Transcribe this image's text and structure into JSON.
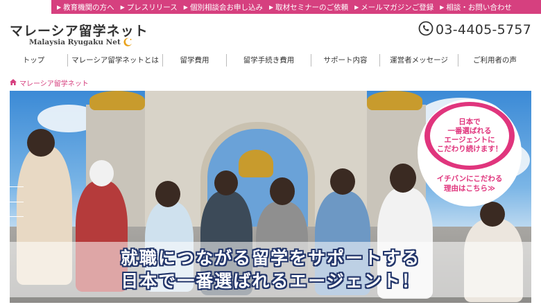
{
  "topbar": {
    "links": [
      "教育機関の方へ",
      "プレスリリース",
      "個別相談会お申し込み",
      "取材セミナーのご依頼",
      "メールマガジンご登録",
      "相談・お問い合わせ"
    ]
  },
  "header": {
    "logo_main": "マレーシア留学ネット",
    "logo_sub": "Malaysia Ryugaku Net",
    "phone": "03-4405-5757"
  },
  "nav": {
    "items": [
      "トップ",
      "マレーシア留学ネットとは",
      "留学費用",
      "留学手続き費用",
      "サポート内容",
      "運営者メッセージ",
      "ご利用者の声"
    ]
  },
  "breadcrumb": {
    "label": "マレーシア留学ネット"
  },
  "hero": {
    "badge_lines": [
      "日本で",
      "一番選ばれる",
      "エージェントに",
      "こだわり続けます！"
    ],
    "badge_link_lines": [
      "イチバンにこだわる",
      "理由はこちら≫"
    ],
    "caption_lines": [
      "就職につながる留学をサポートする",
      "日本で一番選ばれるエージェント！"
    ]
  },
  "colors": {
    "accent": "#d6407f",
    "caption_outline": "#23366b"
  },
  "icons": {
    "phone": "phone-icon",
    "home": "home-icon",
    "moon": "crescent-moon-icon",
    "arrow": "arrow-right-icon"
  }
}
